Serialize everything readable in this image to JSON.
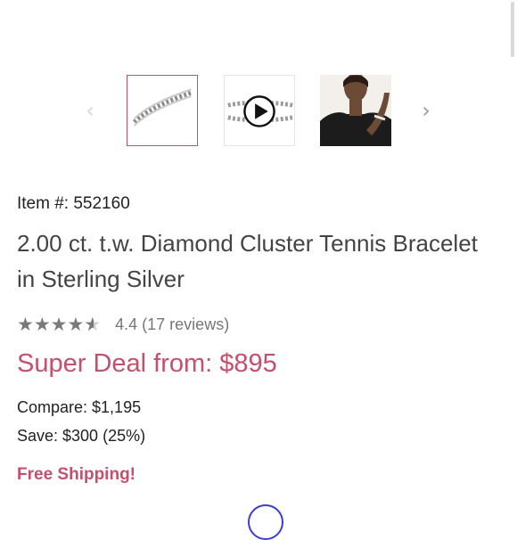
{
  "carousel": {
    "thumbnails": [
      {
        "name": "bracelet-front",
        "selected": true
      },
      {
        "name": "bracelet-video",
        "has_play_icon": true
      },
      {
        "name": "model-wearing-bracelet"
      }
    ],
    "prev_icon": "chevron-left-icon",
    "next_icon": "chevron-right-icon"
  },
  "product": {
    "item_number": "Item #: 552160",
    "title": "2.00 ct. t.w. Diamond Cluster Tennis Bracelet in Sterling Silver",
    "rating_value": 4.4,
    "rating_text": "4.4 (17 reviews)",
    "deal_price": "Super Deal from: $895",
    "compare_price": "Compare: $1,195",
    "savings": "Save: $300 (25%)",
    "shipping": "Free Shipping!"
  },
  "colors": {
    "accent": "#c4506e",
    "star": "#7a7a7a",
    "play_ring": "#3b3bd6"
  }
}
